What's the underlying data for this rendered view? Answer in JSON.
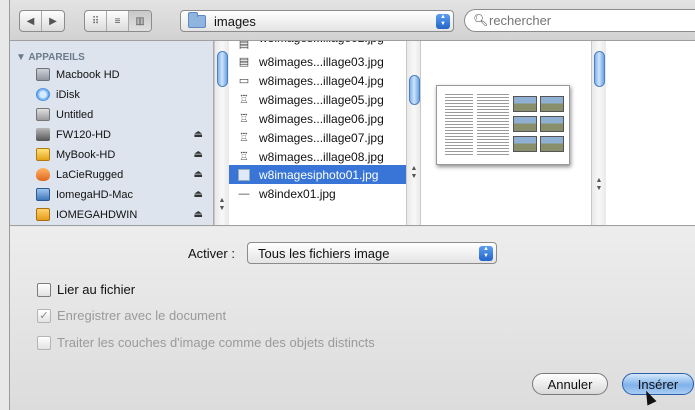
{
  "toolbar": {
    "back_icon": "chevron-left-icon",
    "forward_icon": "chevron-right-icon",
    "view_icons": [
      "grid-view-icon",
      "list-view-icon",
      "column-view-icon"
    ],
    "location": "images",
    "search_placeholder": "rechercher"
  },
  "sidebar": {
    "section_title": "APPAREILS",
    "items": [
      {
        "label": "Macbook HD",
        "icon": "hard-drive-icon",
        "eject": false
      },
      {
        "label": "iDisk",
        "icon": "idisk-icon",
        "eject": false
      },
      {
        "label": "Untitled",
        "icon": "volume-icon",
        "eject": false
      },
      {
        "label": "FW120-HD",
        "icon": "external-drive-icon",
        "eject": true
      },
      {
        "label": "MyBook-HD",
        "icon": "external-drive-icon",
        "eject": true
      },
      {
        "label": "LaCieRugged",
        "icon": "external-drive-icon",
        "eject": true
      },
      {
        "label": "IomegaHD-Mac",
        "icon": "external-drive-icon",
        "eject": true
      },
      {
        "label": "IOMEGAHDWIN",
        "icon": "external-drive-icon",
        "eject": true
      }
    ]
  },
  "files": [
    {
      "name": "w8images...illage03.jpg",
      "selected": false
    },
    {
      "name": "w8images...illage04.jpg",
      "selected": false
    },
    {
      "name": "w8images...illage05.jpg",
      "selected": false
    },
    {
      "name": "w8images...illage06.jpg",
      "selected": false
    },
    {
      "name": "w8images...illage07.jpg",
      "selected": false
    },
    {
      "name": "w8images...illage08.jpg",
      "selected": false
    },
    {
      "name": "w8imagesiphoto01.jpg",
      "selected": true
    },
    {
      "name": "w8index01.jpg",
      "selected": false
    }
  ],
  "options": {
    "activer_label": "Activer :",
    "activer_value": "Tous les fichiers image",
    "checkboxes": [
      {
        "label": "Lier au fichier",
        "checked": false,
        "enabled": true
      },
      {
        "label": "Enregistrer avec le document",
        "checked": true,
        "enabled": false
      },
      {
        "label": "Traiter les couches d'image comme des objets distincts",
        "checked": false,
        "enabled": false
      }
    ]
  },
  "buttons": {
    "cancel": "Annuler",
    "insert": "Insérer"
  },
  "colors": {
    "selection": "#3875d7",
    "sidebar_bg": "#dde4ee",
    "accent": "#2364c8"
  }
}
